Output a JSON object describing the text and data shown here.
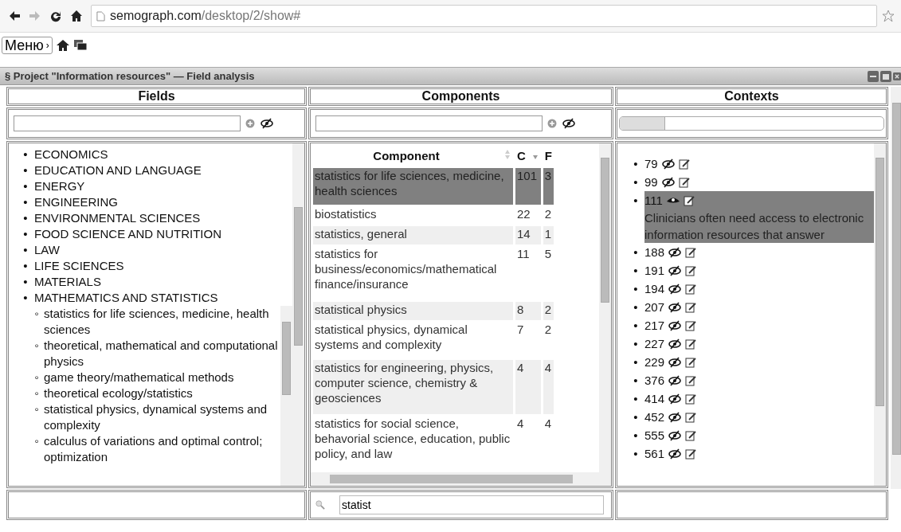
{
  "browser": {
    "url_host": "semograph.com",
    "url_path": "/desktop/2/show#",
    "forward_disabled": true
  },
  "menu": {
    "label": "Меню",
    "arrow": "›"
  },
  "window": {
    "title": "§ Project \"Information resources\" — Field analysis"
  },
  "columns": [
    "Fields",
    "Components",
    "Contexts"
  ],
  "fields": {
    "items": [
      {
        "marker": "•",
        "label": "ECONOMICS"
      },
      {
        "marker": "•",
        "label": "EDUCATION AND LANGUAGE"
      },
      {
        "marker": "•",
        "label": "ENERGY"
      },
      {
        "marker": "•",
        "label": "ENGINEERING"
      },
      {
        "marker": "•",
        "label": "ENVIRONMENTAL SCIENCES"
      },
      {
        "marker": "•",
        "label": "FOOD SCIENCE AND NUTRITION"
      },
      {
        "marker": "•",
        "label": "LAW"
      },
      {
        "marker": "•",
        "label": "LIFE SCIENCES"
      },
      {
        "marker": "•",
        "label": "MATERIALS"
      },
      {
        "marker": "•",
        "label": "MATHEMATICS AND STATISTICS",
        "children": [
          {
            "marker": "◦",
            "label": "statistics for life sciences, medicine, health sciences"
          },
          {
            "marker": "◦",
            "label": "theoretical, mathematical and computational physics"
          },
          {
            "marker": "◦",
            "label": "game theory/mathematical methods"
          },
          {
            "marker": "◦",
            "label": "theoretical ecology/statistics"
          },
          {
            "marker": "◦",
            "label": "statistical physics, dynamical systems and complexity"
          },
          {
            "marker": "◦",
            "label": "calculus of variations and optimal control; optimization"
          }
        ]
      }
    ]
  },
  "components": {
    "headers": [
      "Component",
      "C",
      "F"
    ],
    "search": "statist",
    "rows": [
      {
        "name": "statistics for life sciences, medicine, health sciences",
        "c": "101",
        "f": "3",
        "selected": true
      },
      {
        "name": "biostatistics",
        "c": "22",
        "f": "2",
        "selected": false
      },
      {
        "name": "statistics, general",
        "c": "14",
        "f": "1",
        "selected": false
      },
      {
        "name": "statistics for business/economics/mathematical finance/insurance",
        "c": "11",
        "f": "5",
        "selected": false
      },
      {
        "name": "statistical physics",
        "c": "8",
        "f": "2",
        "selected": false
      },
      {
        "name": "statistical physics, dynamical systems and complexity",
        "c": "7",
        "f": "2",
        "selected": false
      },
      {
        "name": "statistics for engineering, physics, computer science, chemistry & geosciences",
        "c": "4",
        "f": "4",
        "selected": false
      },
      {
        "name": "statistics for social science, behavorial science, education, public policy, and law",
        "c": "4",
        "f": "4",
        "selected": false
      }
    ]
  },
  "contexts": {
    "progress": {
      "level": 0.17
    },
    "items": [
      {
        "marker": "•",
        "number": "79",
        "visible": false,
        "selected": false
      },
      {
        "marker": "•",
        "number": "99",
        "visible": false,
        "selected": false
      },
      {
        "marker": "•",
        "number": "111",
        "visible": true,
        "selected": true,
        "text": "Clinicians often need access to electronic information resources that answer"
      },
      {
        "marker": "•",
        "number": "188",
        "visible": false,
        "selected": false
      },
      {
        "marker": "•",
        "number": "191",
        "visible": false,
        "selected": false
      },
      {
        "marker": "•",
        "number": "194",
        "visible": false,
        "selected": false
      },
      {
        "marker": "•",
        "number": "207",
        "visible": false,
        "selected": false
      },
      {
        "marker": "•",
        "number": "217",
        "visible": false,
        "selected": false
      },
      {
        "marker": "•",
        "number": "227",
        "visible": false,
        "selected": false
      },
      {
        "marker": "•",
        "number": "229",
        "visible": false,
        "selected": false
      },
      {
        "marker": "•",
        "number": "376",
        "visible": false,
        "selected": false
      },
      {
        "marker": "•",
        "number": "414",
        "visible": false,
        "selected": false
      },
      {
        "marker": "•",
        "number": "452",
        "visible": false,
        "selected": false
      },
      {
        "marker": "•",
        "number": "555",
        "visible": false,
        "selected": false
      },
      {
        "marker": "•",
        "number": "561",
        "visible": false,
        "selected": false
      }
    ]
  }
}
